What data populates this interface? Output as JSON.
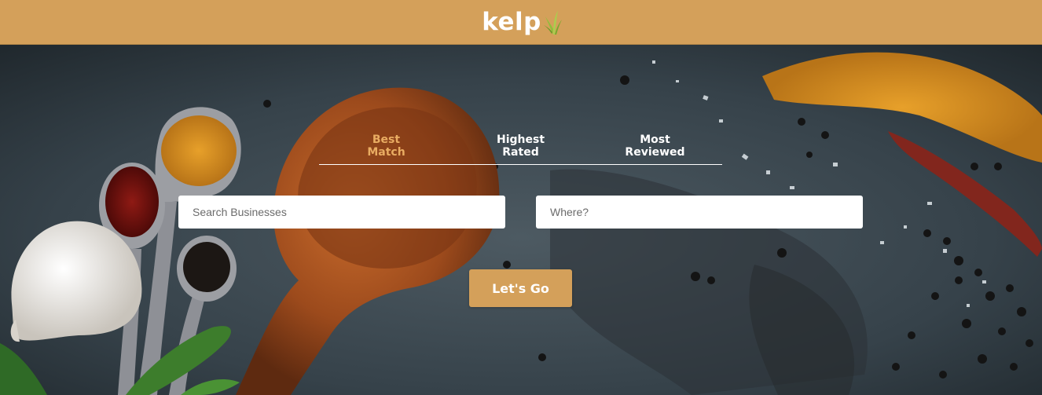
{
  "header": {
    "logo_text": "kelp",
    "logo_icon": "kelp-leaf-icon",
    "background_color": "#d4a05a"
  },
  "sort_options": [
    {
      "line1": "Best",
      "line2": "Match",
      "active": true
    },
    {
      "line1": "Highest",
      "line2": "Rated",
      "active": false
    },
    {
      "line1": "Most",
      "line2": "Reviewed",
      "active": false
    }
  ],
  "search": {
    "business_placeholder": "Search Businesses",
    "business_value": "",
    "location_placeholder": "Where?",
    "location_value": ""
  },
  "submit": {
    "label": "Let's Go",
    "color": "#d4a05a"
  },
  "colors": {
    "accent": "#e9ac62",
    "tab_text": "#ffffff"
  }
}
